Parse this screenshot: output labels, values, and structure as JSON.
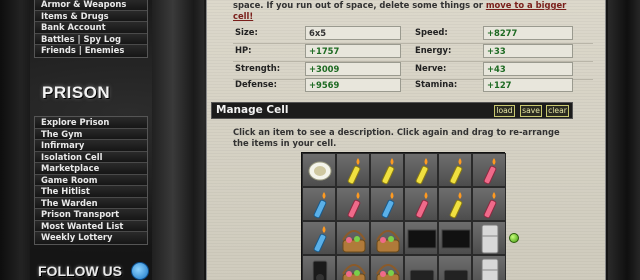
{
  "sidebar": {
    "top_menu": [
      "Armor & Weapons",
      "Items & Drugs",
      "Bank Account",
      "Battles  |  Spy Log",
      "Friends  |  Enemies"
    ],
    "prison_header": "PRISON",
    "prison_menu": [
      "Explore Prison",
      "The Gym",
      "Infirmary",
      "Isolation Cell",
      "Marketplace",
      "Game Room",
      "The Hitlist",
      "The Warden",
      "Prison Transport",
      "Most Wanted List",
      "Weekly Lottery"
    ],
    "follow_header": "FOLLOW US",
    "follow_icon": "bird-icon"
  },
  "main": {
    "intro_text": "space. If you run out of space, delete some things or ",
    "intro_link": "move to a bigger",
    "intro_link_cont": "cell!",
    "stats": {
      "size_label": "Size:",
      "size_value": "6x5",
      "speed_label": "Speed:",
      "speed_value": "+8277",
      "hp_label": "HP:",
      "hp_value": "+1757",
      "energy_label": "Energy:",
      "energy_value": "+33",
      "strength_label": "Strength:",
      "strength_value": "+3009",
      "nerve_label": "Nerve:",
      "nerve_value": "+43",
      "defense_label": "Defense:",
      "defense_value": "+9569",
      "stamina_label": "Stamina:",
      "stamina_value": "+127"
    },
    "manage_cell": {
      "title": "Manage Cell",
      "load_label": "load",
      "save_label": "save",
      "clear_label": "clear"
    },
    "help_text": "Click an item to see a description. Click again and drag to re-arrange the items in your cell.",
    "grid_items": [
      [
        "toilet",
        "yellow-candle",
        "yellow-candle",
        "yellow-candle",
        "yellow-candle",
        "pink-candle"
      ],
      [
        "blue-candle",
        "pink-candle",
        "blue-candle",
        "pink-candle",
        "yellow-candle",
        "pink-candle"
      ],
      [
        "blue-candle",
        "easter-basket",
        "easter-basket",
        "tv",
        "tv",
        "fridge"
      ],
      [
        "speaker",
        "easter-basket",
        "easter-basket",
        "console",
        "console",
        "fridge"
      ]
    ],
    "colors": {
      "stat_value": "#1d6a22",
      "bar": "#1c1c1c",
      "link": "#7a1f1a"
    }
  }
}
